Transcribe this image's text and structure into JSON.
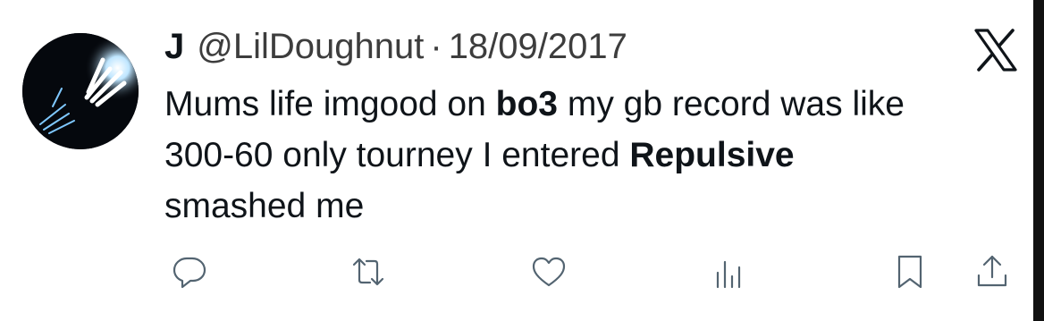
{
  "tweet": {
    "display_name": "J",
    "handle": "@LilDoughnut",
    "separator": "·",
    "date": "18/09/2017",
    "body": {
      "line1_a": "Mums life imgood on ",
      "line1_b": "bo3",
      "line1_c": " my gb record was like",
      "line2_a": "300-60 only tourney I entered ",
      "line2_b": "Repulsive",
      "line3": "smashed me"
    }
  },
  "icons": {
    "brand": "x-logo-icon",
    "avatar": "glowing-hands-avatar",
    "actions": [
      "reply-icon",
      "retweet-icon",
      "like-icon",
      "views-icon",
      "bookmark-icon",
      "share-icon"
    ]
  },
  "colors": {
    "text": "#0f1419",
    "muted": "#3d3d3d",
    "icon": "#536471",
    "background": "#ffffff"
  }
}
